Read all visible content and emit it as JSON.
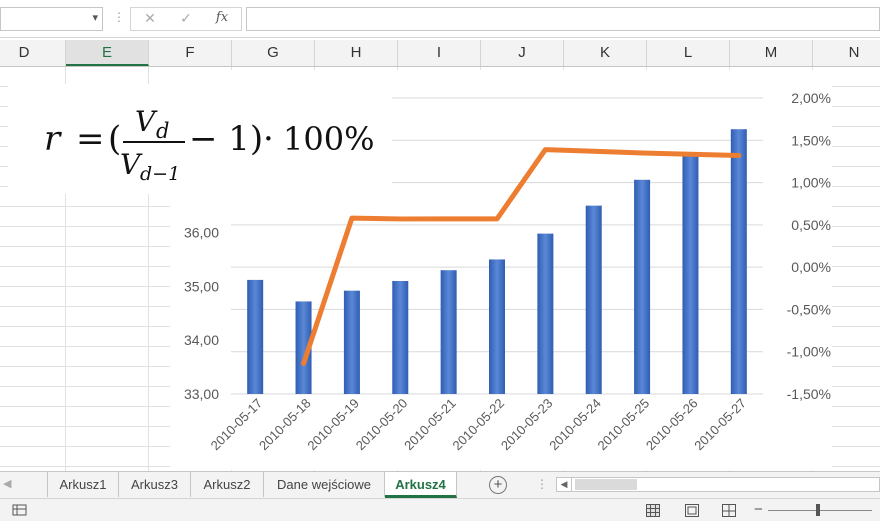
{
  "formula_bar": {
    "name_box_value": "",
    "separator": "⋮",
    "cancel_icon": "✕",
    "enter_icon": "✓",
    "fx_label": "fx",
    "formula_value": ""
  },
  "columns": [
    "D",
    "E",
    "F",
    "G",
    "H",
    "I",
    "J",
    "K",
    "L",
    "M",
    "N"
  ],
  "active_column": "E",
  "formula_image": {
    "lhs": "r",
    "equals": "=",
    "open": "(",
    "numerator": "V",
    "numerator_sub": "d",
    "denominator": "V",
    "denominator_sub": "d−1",
    "minus_one": "− 1)",
    "times": "·",
    "percent": "100%"
  },
  "chart_data": {
    "type": "bar+line",
    "categories": [
      "2010-05-17",
      "2010-05-18",
      "2010-05-19",
      "2010-05-20",
      "2010-05-21",
      "2010-05-22",
      "2010-05-23",
      "2010-05-24",
      "2010-05-25",
      "2010-05-26",
      "2010-05-27"
    ],
    "bar_series": {
      "values": [
        35.12,
        34.72,
        34.92,
        35.1,
        35.3,
        35.5,
        35.98,
        36.5,
        36.98,
        37.42,
        37.92
      ],
      "color": "#4472c4",
      "axis": "left"
    },
    "line_series": {
      "x_start": "2010-05-18",
      "values": [
        -1.14,
        0.58,
        0.57,
        0.57,
        0.57,
        1.39,
        1.37,
        1.35,
        1.32
      ],
      "x_categories": [
        "2010-05-18",
        "2010-05-19",
        "2010-05-20",
        "2010-05-21",
        "2010-05-22",
        "2010-05-23",
        "2010-05-24",
        "2010-05-25",
        "2010-05-27"
      ],
      "color": "#ed7d31",
      "axis": "right"
    },
    "left_axis": {
      "ticks": [
        "33,00",
        "34,00",
        "35,00",
        "36,00"
      ],
      "tick_values": [
        33,
        34,
        35,
        36
      ],
      "ylim": [
        33,
        38.5
      ]
    },
    "right_axis": {
      "ticks": [
        "2,00%",
        "1,50%",
        "1,00%",
        "0,50%",
        "0,00%",
        "-0,50%",
        "-1,00%",
        "-1,50%"
      ],
      "tick_values": [
        2.0,
        1.5,
        1.0,
        0.5,
        0.0,
        -0.5,
        -1.0,
        -1.5
      ],
      "ylim": [
        -1.5,
        2.0
      ]
    },
    "grid": true,
    "legend": "none"
  },
  "sheet_tabs": [
    {
      "label": "Arkusz1",
      "active": false
    },
    {
      "label": "Arkusz3",
      "active": false
    },
    {
      "label": "Arkusz2",
      "active": false
    },
    {
      "label": "Dane wejściowe",
      "active": false
    },
    {
      "label": "Arkusz4",
      "active": true
    }
  ],
  "tabbar": {
    "add_sheet": "+",
    "dots": "⋮",
    "scroll_left": "◀"
  },
  "statusbar": {
    "zoom_minus": "−"
  },
  "colors": {
    "accent": "#217346",
    "bar": "#4472c4",
    "line": "#ed7d31"
  }
}
